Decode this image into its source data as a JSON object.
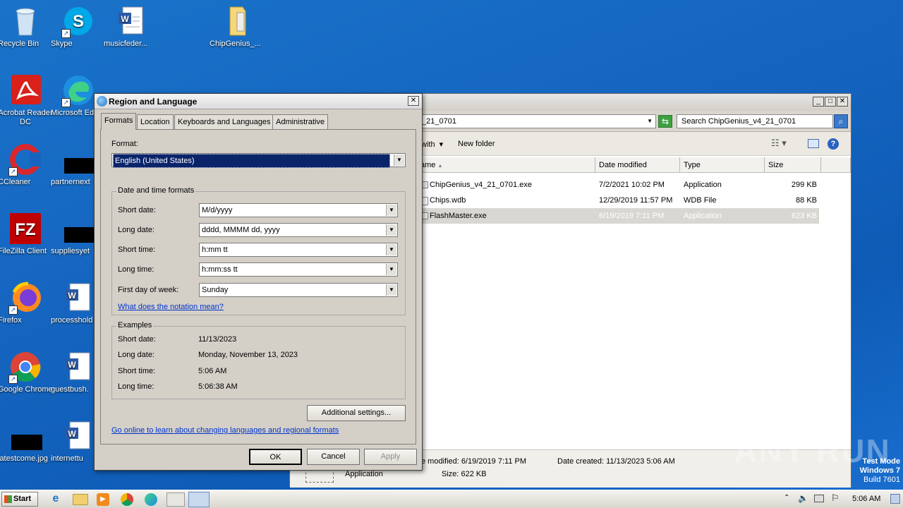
{
  "desktop": {
    "icons": [
      {
        "label": "Recycle Bin",
        "icon": "recycle-bin-icon"
      },
      {
        "label": "Skype",
        "icon": "skype-icon"
      },
      {
        "label": "musicfeder...",
        "icon": "word-document-icon"
      },
      {
        "label": "ChipGenius_...",
        "icon": "folder-icon"
      },
      {
        "label": "Acrobat Reader DC",
        "icon": "acrobat-icon"
      },
      {
        "label": "Microsoft Ed",
        "icon": "edge-icon"
      },
      {
        "label": "CCleaner",
        "icon": "ccleaner-icon"
      },
      {
        "label": "partnernext",
        "icon": "black-file-icon"
      },
      {
        "label": "FileZilla Client",
        "icon": "filezilla-icon"
      },
      {
        "label": "suppliesyet",
        "icon": "black-file-icon"
      },
      {
        "label": "Firefox",
        "icon": "firefox-icon"
      },
      {
        "label": "processhold",
        "icon": "word-document-icon"
      },
      {
        "label": "Google Chrome",
        "icon": "chrome-icon"
      },
      {
        "label": "guestbush.",
        "icon": "word-document-icon"
      },
      {
        "label": "latestcome.jpg",
        "icon": "black-file-icon"
      },
      {
        "label": "internettu",
        "icon": "word-document-icon"
      }
    ],
    "watermark": "ANY RUN",
    "test_mode": {
      "line1": "Test Mode",
      "line2": "Windows 7",
      "line3": "Build 7601"
    }
  },
  "explorer": {
    "address_partial": "_21_0701",
    "search_placeholder": "Search ChipGenius_v4_21_0701",
    "cmd_with": "with",
    "cmd_new_folder": "New folder",
    "columns": [
      "ame",
      "Date modified",
      "Type",
      "Size"
    ],
    "rows": [
      {
        "name": "ChipGenius_v4_21_0701.exe",
        "date": "7/2/2021 10:02 PM",
        "type": "Application",
        "size": "299 KB"
      },
      {
        "name": "Chips.wdb",
        "date": "12/29/2019 11:57 PM",
        "type": "WDB File",
        "size": "88 KB"
      },
      {
        "name": "FlashMaster.exe",
        "date": "6/19/2019 7:11 PM",
        "type": "Application",
        "size": "623 KB"
      }
    ],
    "details": {
      "modified": "e modified:  6/19/2019 7:11 PM",
      "created": "Date created:  11/13/2023 5:06 AM",
      "type": "Application",
      "size": "Size:  622 KB"
    }
  },
  "dialog": {
    "title": "Region and Language",
    "tabs": [
      "Formats",
      "Location",
      "Keyboards and Languages",
      "Administrative"
    ],
    "format_label": "Format:",
    "format_value": "English (United States)",
    "datetime_group": "Date and time formats",
    "fields": [
      {
        "label": "Short date:",
        "value": "M/d/yyyy"
      },
      {
        "label": "Long date:",
        "value": "dddd, MMMM dd, yyyy"
      },
      {
        "label": "Short time:",
        "value": "h:mm tt"
      },
      {
        "label": "Long time:",
        "value": "h:mm:ss tt"
      },
      {
        "label": "First day of week:",
        "value": "Sunday"
      }
    ],
    "notation_link": "What does the notation mean?",
    "examples_group": "Examples",
    "examples": [
      {
        "label": "Short date:",
        "value": "11/13/2023"
      },
      {
        "label": "Long date:",
        "value": "Monday, November 13, 2023"
      },
      {
        "label": "Short time:",
        "value": "5:06 AM"
      },
      {
        "label": "Long time:",
        "value": "5:06:38 AM"
      }
    ],
    "additional_settings": "Additional settings...",
    "online_link": "Go online to learn about changing languages and regional formats",
    "ok": "OK",
    "cancel": "Cancel",
    "apply": "Apply"
  },
  "taskbar": {
    "start": "Start",
    "clock": "5:06 AM"
  }
}
